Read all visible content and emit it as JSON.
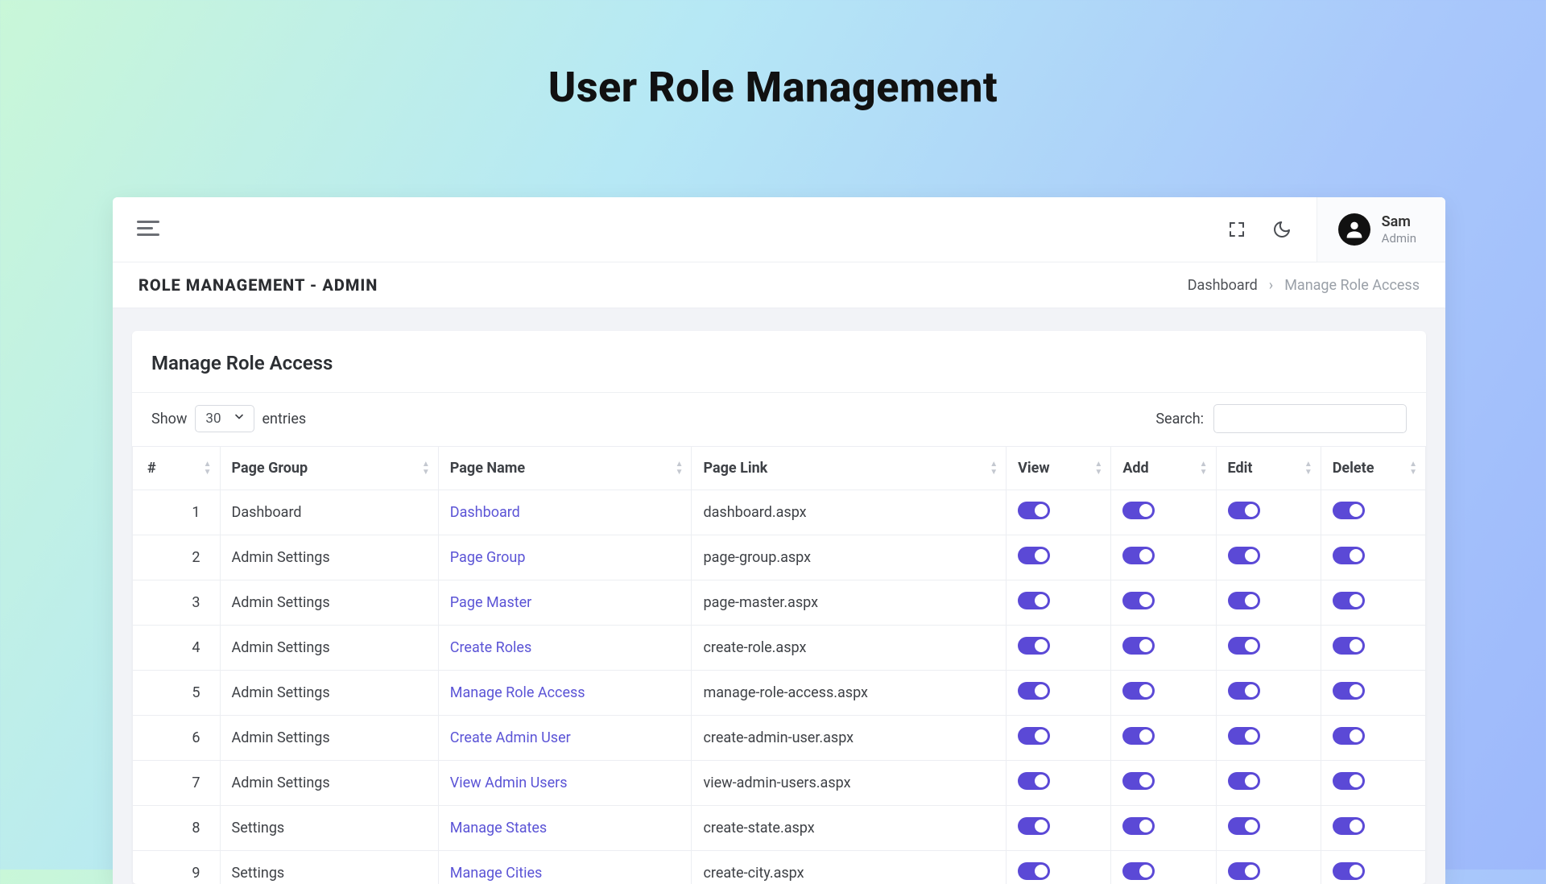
{
  "hero": {
    "title": "User Role Management"
  },
  "topbar": {
    "user_name": "Sam",
    "user_role": "Admin"
  },
  "subhead": {
    "title": "ROLE MANAGEMENT - ADMIN",
    "breadcrumb": {
      "root": "Dashboard",
      "current": "Manage Role Access"
    }
  },
  "card": {
    "title": "Manage Role Access",
    "show_label": "Show",
    "entries_label": "entries",
    "page_size": "30",
    "search_label": "Search:"
  },
  "columns": {
    "idx": "#",
    "page_group": "Page Group",
    "page_name": "Page Name",
    "page_link": "Page Link",
    "view": "View",
    "add": "Add",
    "edit": "Edit",
    "delete": "Delete"
  },
  "rows": [
    {
      "idx": "1",
      "group": "Dashboard",
      "name": "Dashboard",
      "link": "dashboard.aspx"
    },
    {
      "idx": "2",
      "group": "Admin Settings",
      "name": "Page Group",
      "link": "page-group.aspx"
    },
    {
      "idx": "3",
      "group": "Admin Settings",
      "name": "Page Master",
      "link": "page-master.aspx"
    },
    {
      "idx": "4",
      "group": "Admin Settings",
      "name": "Create Roles",
      "link": "create-role.aspx"
    },
    {
      "idx": "5",
      "group": "Admin Settings",
      "name": "Manage Role Access",
      "link": "manage-role-access.aspx"
    },
    {
      "idx": "6",
      "group": "Admin Settings",
      "name": "Create Admin User",
      "link": "create-admin-user.aspx"
    },
    {
      "idx": "7",
      "group": "Admin Settings",
      "name": "View Admin Users",
      "link": "view-admin-users.aspx"
    },
    {
      "idx": "8",
      "group": "Settings",
      "name": "Manage States",
      "link": "create-state.aspx"
    },
    {
      "idx": "9",
      "group": "Settings",
      "name": "Manage Cities",
      "link": "create-city.aspx"
    }
  ]
}
